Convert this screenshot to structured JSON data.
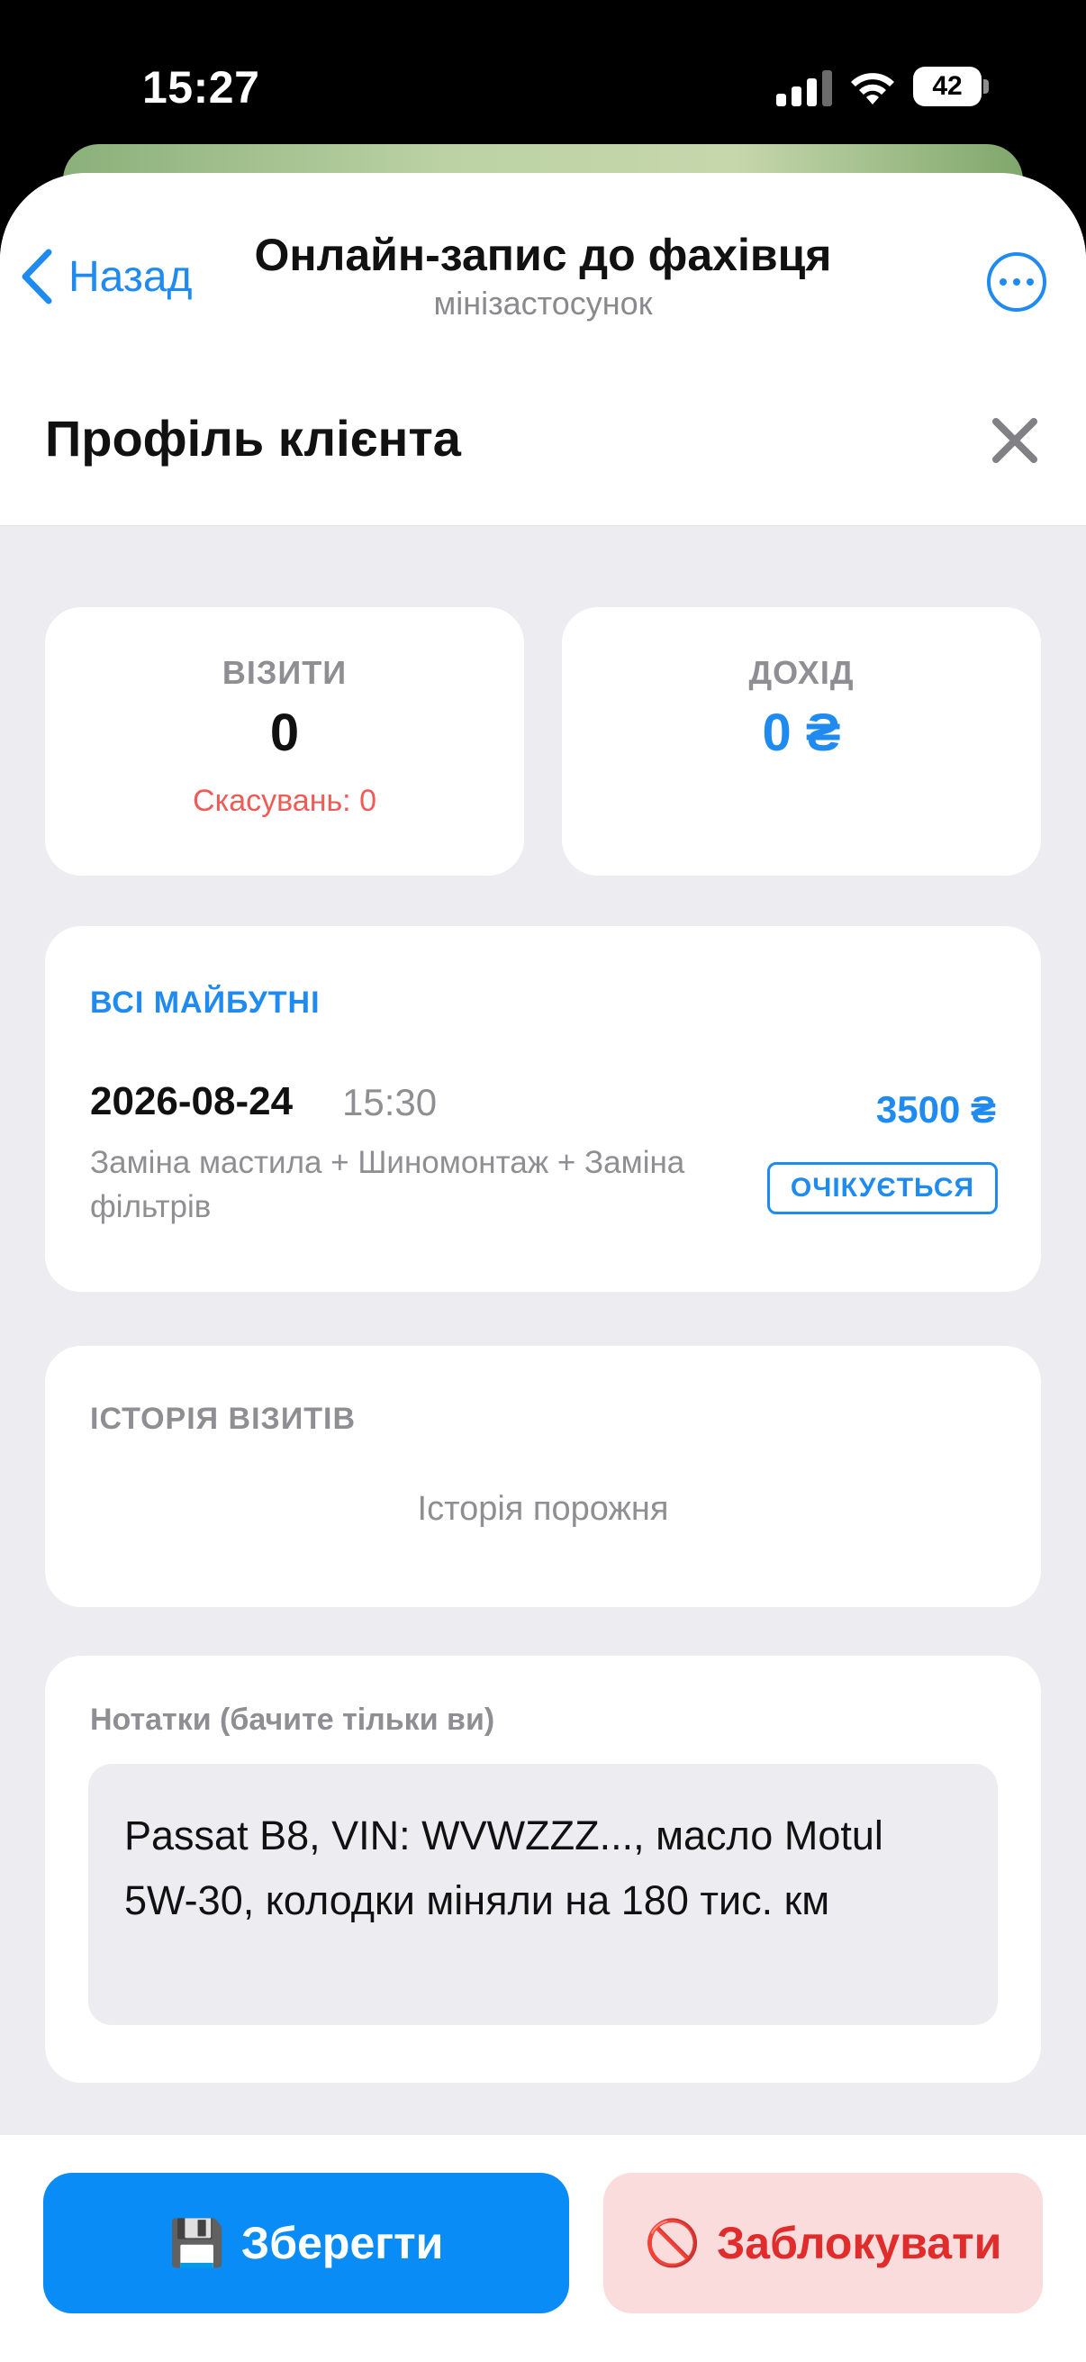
{
  "status_bar": {
    "time": "15:27",
    "battery": "42"
  },
  "nav": {
    "back_label": "Назад",
    "title": "Онлайн-запис до фахівця",
    "subtitle": "мінізастосунок"
  },
  "page": {
    "title": "Профіль клієнта"
  },
  "stats": {
    "visits": {
      "label": "ВІЗИТИ",
      "value": "0",
      "cancellations": "Скасувань: 0"
    },
    "income": {
      "label": "ДОХІД",
      "value": "0 ₴"
    }
  },
  "upcoming": {
    "title": "ВСІ МАЙБУТНІ",
    "items": [
      {
        "date": "2026-08-24",
        "time": "15:30",
        "services": "Заміна мастила + Шиномонтаж + Заміна фільтрів",
        "price": "3500 ₴",
        "status": "ОЧІКУЄТЬСЯ"
      }
    ]
  },
  "history": {
    "title": "ІСТОРІЯ ВІЗИТІВ",
    "empty_text": "Історія порожня"
  },
  "notes": {
    "label": "Нотатки (бачите тільки ви)",
    "value": "Passat B8, VIN: WVWZZZ..., масло Motul 5W-30, колодки міняли на 180 тис. км"
  },
  "actions": {
    "save_label": "Зберегти",
    "save_icon": "💾",
    "block_label": "Заблокувати",
    "block_icon": "🚫"
  },
  "colors": {
    "accent": "#1f8bf0",
    "danger": "#e12c2c",
    "danger_bg": "#fbdcdc",
    "cancel_text": "#ef5b57"
  }
}
